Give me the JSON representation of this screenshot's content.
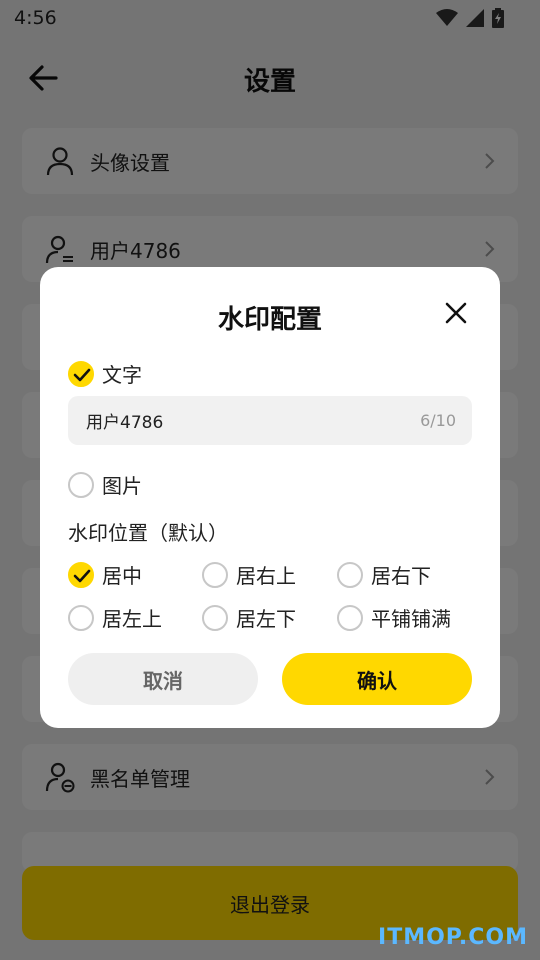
{
  "status": {
    "time": "4:56"
  },
  "header": {
    "title": "设置"
  },
  "settings": {
    "items": [
      {
        "label": "头像设置"
      },
      {
        "label": "用户4786"
      },
      {
        "label": ""
      },
      {
        "label": ""
      },
      {
        "label": ""
      },
      {
        "label": ""
      },
      {
        "label": ""
      },
      {
        "label": "黑名单管理"
      },
      {
        "label": ""
      }
    ],
    "logout_label": "退出登录"
  },
  "dialog": {
    "title": "水印配置",
    "text_option": {
      "label": "文字",
      "checked": true
    },
    "text_input": {
      "value": "用户4786",
      "counter": "6/10"
    },
    "image_option": {
      "label": "图片",
      "checked": false
    },
    "position_label": "水印位置（默认）",
    "positions": [
      {
        "label": "居中",
        "checked": true
      },
      {
        "label": "居右上",
        "checked": false
      },
      {
        "label": "居右下",
        "checked": false
      },
      {
        "label": "居左上",
        "checked": false
      },
      {
        "label": "居左下",
        "checked": false
      },
      {
        "label": "平铺铺满",
        "checked": false
      }
    ],
    "cancel_label": "取消",
    "confirm_label": "确认"
  },
  "watermark_text": "ITMOP.COM",
  "colors": {
    "accent": "#ffd800",
    "overlay": "rgba(0,0,0,0.5)"
  }
}
